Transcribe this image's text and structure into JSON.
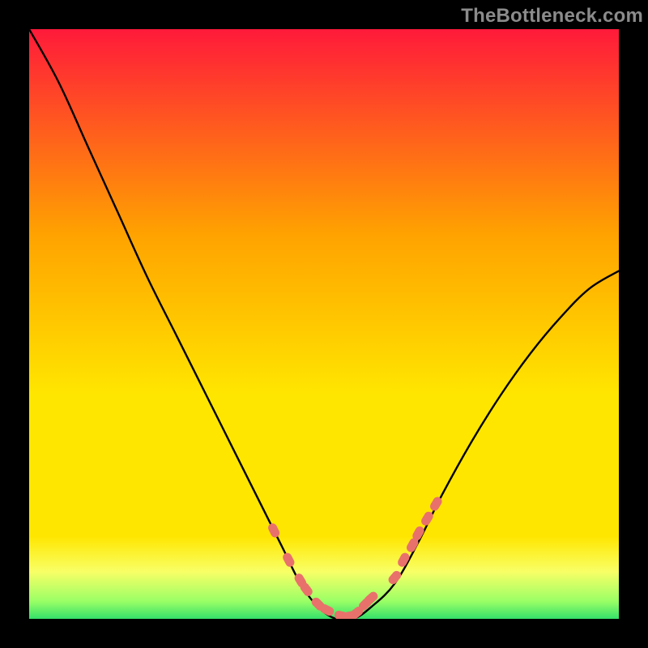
{
  "watermark": "TheBottleneck.com",
  "chart_data": {
    "type": "line",
    "title": "",
    "xlabel": "",
    "ylabel": "",
    "xlim": [
      0,
      100
    ],
    "ylim": [
      0,
      100
    ],
    "grid": false,
    "series": [
      {
        "name": "bottleneck-curve",
        "x": [
          0,
          5,
          10,
          15,
          20,
          25,
          30,
          35,
          40,
          43,
          46,
          49,
          52,
          55,
          58,
          62,
          66,
          70,
          75,
          80,
          85,
          90,
          95,
          100
        ],
        "y": [
          100,
          91,
          80,
          69,
          58,
          48,
          38,
          28,
          18,
          12,
          6,
          2,
          0,
          0,
          2,
          6,
          13,
          21,
          30,
          38,
          45,
          51,
          56,
          59
        ]
      }
    ],
    "markers": {
      "name": "notable-points",
      "x": [
        41.5,
        44,
        46,
        47,
        49,
        50.5,
        53,
        54.5,
        55.5,
        57,
        58,
        62,
        63.5,
        65,
        66,
        67.5,
        69
      ],
      "y": [
        15,
        10,
        6.5,
        5,
        2.5,
        1.5,
        0.5,
        0.5,
        1,
        2.5,
        3.5,
        7,
        10,
        12.5,
        14.5,
        17,
        19.5
      ]
    },
    "gradient_background": {
      "top_color": "#ff1a3a",
      "upper_mid_color": "#ffa300",
      "mid_color": "#ffe600",
      "lower_band_color": "#f8ff66",
      "bottom_color": "#35e06a"
    }
  }
}
